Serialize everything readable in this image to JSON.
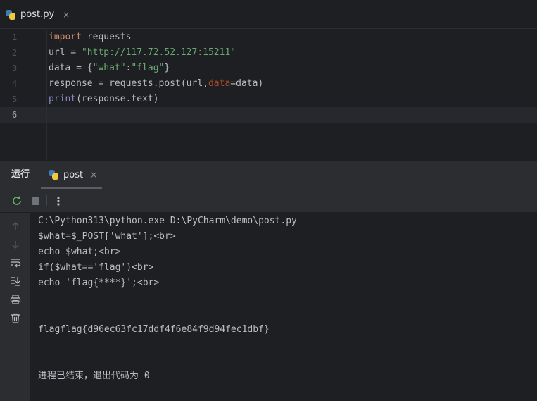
{
  "editor_tab": {
    "label": "post.py",
    "close": "×"
  },
  "editor": {
    "line_numbers": [
      "1",
      "2",
      "3",
      "4",
      "5",
      "6"
    ],
    "line1": {
      "kw": "import",
      "rest": " requests"
    },
    "line2": {
      "pre": "url = ",
      "str": "\"http://117.72.52.127:15211\""
    },
    "line3": {
      "pre": "data = {",
      "k": "\"what\"",
      "colon": ":",
      "v": "\"flag\"",
      "end": "}"
    },
    "line4": {
      "pre": "response = requests.post(url,",
      "param": "data",
      "end": "=data)"
    },
    "line5": {
      "fn": "print",
      "rest": "(response.text)"
    }
  },
  "run_panel": {
    "title": "运行",
    "tab_label": "post",
    "tab_close": "×",
    "more": "⋮"
  },
  "console": {
    "lines": [
      "C:\\Python313\\python.exe D:\\PyCharm\\demo\\post.py",
      "$what=$_POST['what'];<br>",
      "echo $what;<br>",
      "if($what=='flag')<br>",
      "echo 'flag{****}';<br>",
      "flagflag{d96ec63fc17ddf4f6e84f9d94fec1dbf}",
      "进程已结束，退出代码为 0"
    ]
  },
  "icons": {
    "rerun": "rerun-icon",
    "stop": "stop-icon",
    "up": "arrow-up-icon",
    "down": "arrow-down-icon",
    "wrap": "soft-wrap-icon",
    "scroll_end": "scroll-to-end-icon",
    "print": "print-icon",
    "trash": "trash-icon"
  },
  "colors": {
    "accent": "#3574f0",
    "keyword": "#cf8e6d",
    "string": "#6aab73",
    "run_green": "#5fb865"
  }
}
